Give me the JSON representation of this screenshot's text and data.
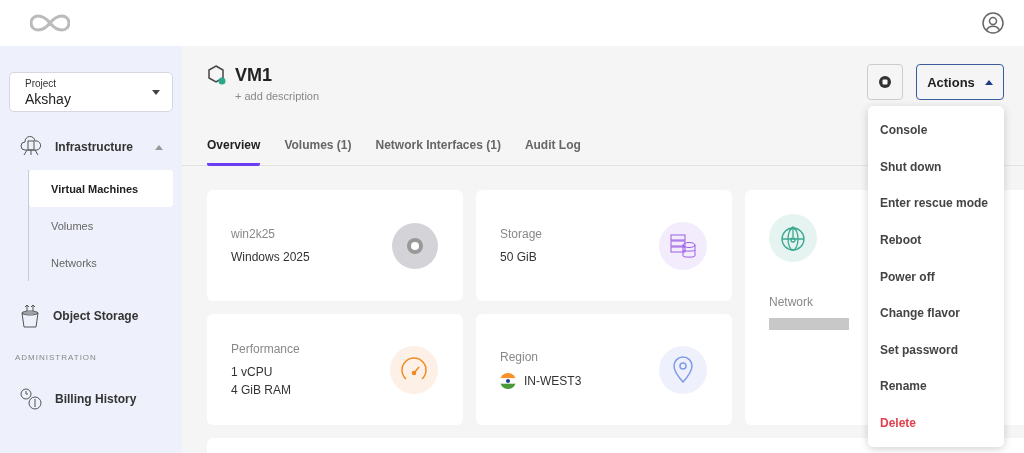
{
  "project": {
    "label": "Project",
    "value": "Akshay"
  },
  "sidebar": {
    "groups": [
      {
        "label": "Infrastructure",
        "kind": "infra",
        "expanded": true,
        "children": [
          {
            "label": "Virtual Machines",
            "selected": true
          },
          {
            "label": "Volumes",
            "selected": false
          },
          {
            "label": "Networks",
            "selected": false
          }
        ]
      },
      {
        "label": "Object Storage",
        "kind": "storage"
      }
    ],
    "section": "ADMINISTRATION",
    "admin": [
      {
        "label": "Billing History",
        "kind": "billing"
      }
    ]
  },
  "vm": {
    "name": "VM1",
    "add_description": "+ add description",
    "running": true
  },
  "actions": {
    "label": "Actions",
    "open": true,
    "items": [
      {
        "label": "Console",
        "kind": "normal"
      },
      {
        "label": "Shut down",
        "kind": "normal"
      },
      {
        "label": "Enter rescue mode",
        "kind": "normal"
      },
      {
        "label": "Reboot",
        "kind": "normal"
      },
      {
        "label": "Power off",
        "kind": "normal"
      },
      {
        "label": "Change flavor",
        "kind": "normal"
      },
      {
        "label": "Set password",
        "kind": "normal"
      },
      {
        "label": "Rename",
        "kind": "normal"
      },
      {
        "label": "Delete",
        "kind": "danger"
      }
    ]
  },
  "tabs": [
    {
      "label": "Overview",
      "selected": true
    },
    {
      "label": "Volumes (1)",
      "selected": false
    },
    {
      "label": "Network Interfaces (1)",
      "selected": false
    },
    {
      "label": "Audit Log",
      "selected": false
    }
  ],
  "cards": [
    {
      "kind": "os",
      "title": "win2k25",
      "lines": [
        "Windows 2025"
      ]
    },
    {
      "kind": "storage",
      "title": "Storage",
      "lines": [
        "50 GiB"
      ]
    },
    {
      "kind": "network",
      "title": "Network"
    },
    {
      "kind": "performance",
      "title": "Performance",
      "lines": [
        "1 vCPU",
        "4 GiB RAM"
      ]
    },
    {
      "kind": "region",
      "title": "Region",
      "lines": [
        "IN-WEST3"
      ]
    }
  ]
}
